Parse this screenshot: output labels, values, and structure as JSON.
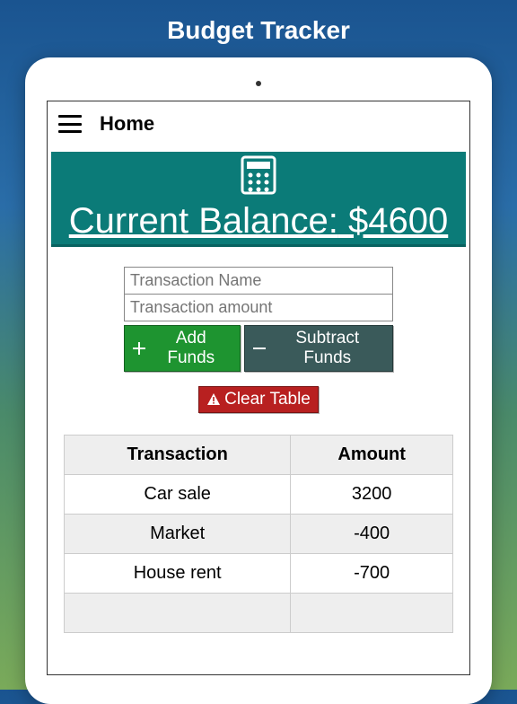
{
  "page_title": "Budget Tracker",
  "topbar": {
    "title": "Home"
  },
  "balance": {
    "label": "Current Balance:",
    "value": "$4600"
  },
  "form": {
    "name_placeholder": "Transaction Name",
    "amount_placeholder": "Transaction amount",
    "add_label": "Add Funds",
    "subtract_label": "Subtract Funds",
    "clear_label": "Clear Table"
  },
  "table": {
    "headers": {
      "transaction": "Transaction",
      "amount": "Amount"
    },
    "rows": [
      {
        "transaction": "Car sale",
        "amount": "3200"
      },
      {
        "transaction": "Market",
        "amount": "-400"
      },
      {
        "transaction": "House rent",
        "amount": "-700"
      }
    ]
  }
}
